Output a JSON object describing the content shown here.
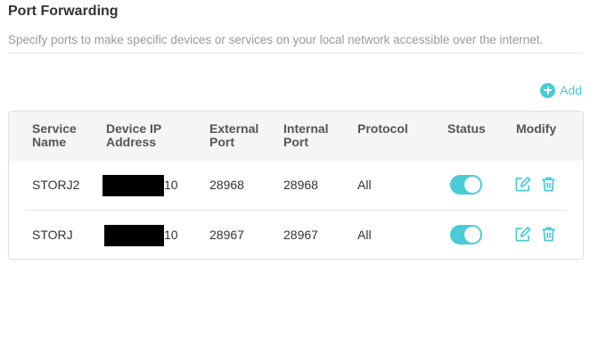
{
  "page": {
    "title": "Port Forwarding",
    "description": "Specify ports to make specific devices or services on your local network accessible over the internet."
  },
  "add_button": {
    "label": "Add",
    "icon": "plus-circle-icon"
  },
  "table": {
    "headers": {
      "service_name": "Service Name",
      "device_ip": "Device IP Address",
      "external_port": "External Port",
      "internal_port": "Internal Port",
      "protocol": "Protocol",
      "status": "Status",
      "modify": "Modify"
    },
    "rows": [
      {
        "service_name": "STORJ2",
        "device_ip_visible": "10",
        "external_port": "28968",
        "internal_port": "28968",
        "protocol": "All",
        "status_enabled": true
      },
      {
        "service_name": "STORJ",
        "device_ip_visible": "10",
        "external_port": "28967",
        "internal_port": "28967",
        "protocol": "All",
        "status_enabled": true
      }
    ]
  },
  "colors": {
    "accent": "#4acbd6",
    "header_bg": "#f5f5f5",
    "text": "#333333",
    "muted": "#9a9a9a"
  },
  "icons": {
    "edit": "edit-icon",
    "delete": "trash-icon"
  }
}
